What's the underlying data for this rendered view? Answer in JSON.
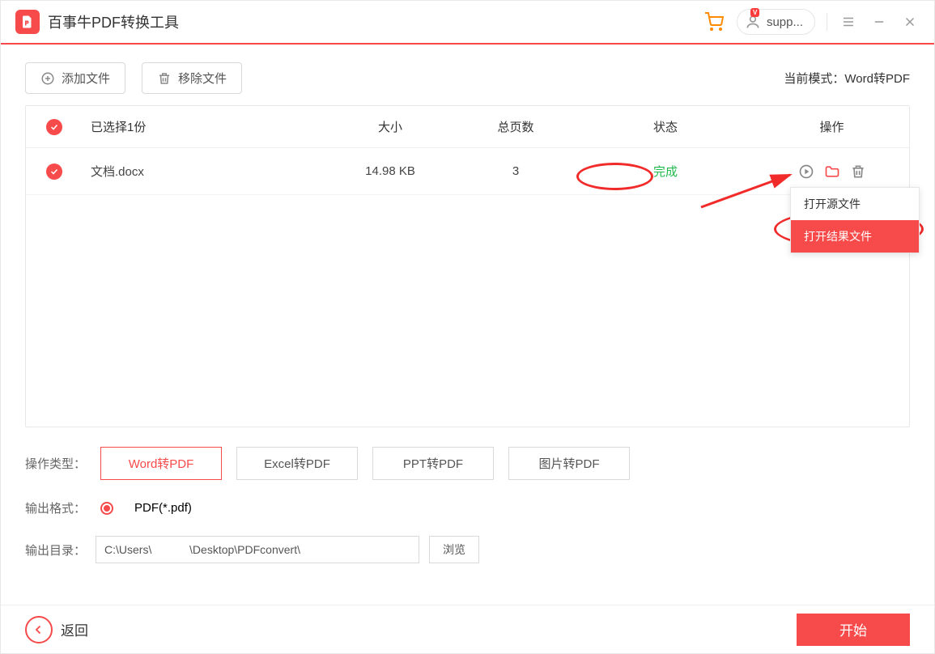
{
  "app": {
    "title": "百事牛PDF转换工具"
  },
  "user": {
    "name": "supp...",
    "vip": "V"
  },
  "toolbar": {
    "add_file": "添加文件",
    "remove_file": "移除文件",
    "mode_prefix": "当前模式：",
    "mode_value": "Word转PDF"
  },
  "table": {
    "header": {
      "name": "已选择1份",
      "size": "大小",
      "pages": "总页数",
      "status": "状态",
      "ops": "操作"
    },
    "rows": [
      {
        "name": "文档.docx",
        "size": "14.98 KB",
        "pages": "3",
        "status": "完成"
      }
    ]
  },
  "popup": {
    "open_source": "打开源文件",
    "open_result": "打开结果文件"
  },
  "options": {
    "type_label": "操作类型：",
    "types": [
      "Word转PDF",
      "Excel转PDF",
      "PPT转PDF",
      "图片转PDF"
    ],
    "active_type_index": 0,
    "format_label": "输出格式：",
    "format_value": "PDF(*.pdf)",
    "dir_label": "输出目录：",
    "dir_value": "C:\\Users\\            \\Desktop\\PDFconvert\\",
    "browse": "浏览"
  },
  "footer": {
    "back": "返回",
    "start": "开始"
  }
}
